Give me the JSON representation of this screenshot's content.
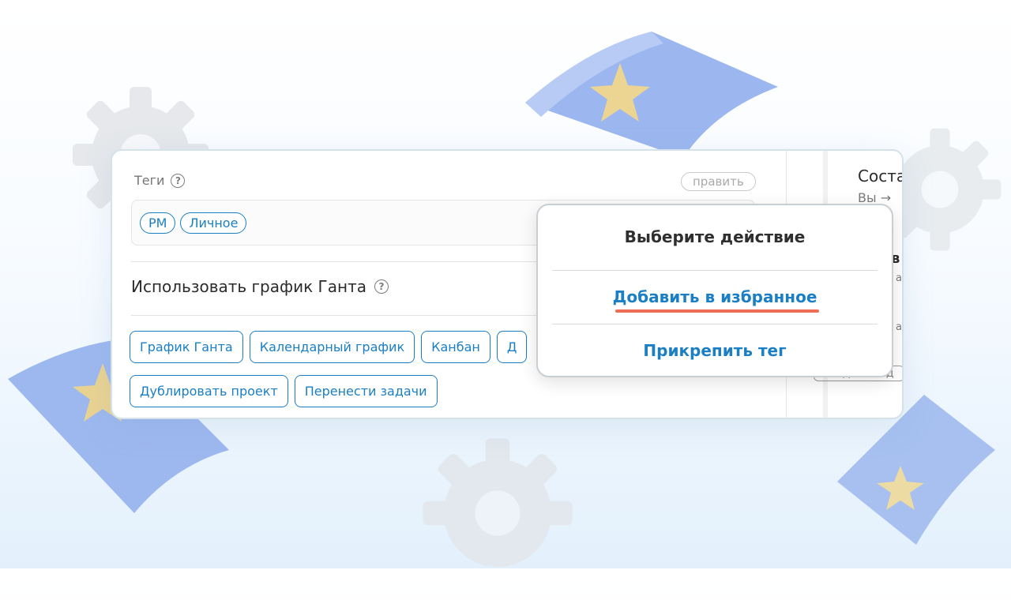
{
  "colors": {
    "accent": "#1a7fc4",
    "highlight": "#ef6d55",
    "text": "#2b2b2b",
    "muted": "#757575"
  },
  "tags_section": {
    "label": "Теги",
    "help_icon": "question-circle-icon",
    "edit_label": "править",
    "tags": [
      "PM",
      "Личное"
    ]
  },
  "gantt_section": {
    "title": "Использовать график Ганта",
    "help_icon": "question-circle-icon",
    "buttons_row1": [
      "График Ганта",
      "Календарный график",
      "Канбан",
      "Д"
    ],
    "buttons_row2": [
      "Дублировать проект",
      "Перенести задачи"
    ]
  },
  "right_panel": {
    "title_fragment": "Соста",
    "subtitle_fragment": "Вы →",
    "fragment_1": "в",
    "fragment_2": "а",
    "fragment_3": "а",
    "button_fragment": "создать зад"
  },
  "popup": {
    "title": "Выберите действие",
    "action_favorites": "Добавить в избранное",
    "action_attach_tag": "Прикрепить тег"
  }
}
